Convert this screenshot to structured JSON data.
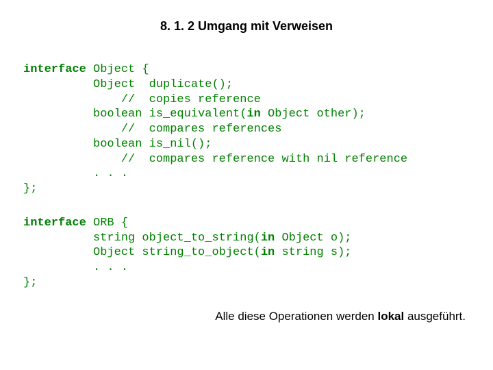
{
  "heading": "8. 1. 2  Umgang mit Verweisen",
  "code1": {
    "kw1": "interface",
    "l1b": " Object {",
    "l2": "          Object  duplicate();",
    "l3": "              //  copies reference",
    "l4a": "          boolean is_equivalent(",
    "kw_in1": "in",
    "l4b": " Object other);",
    "l5": "              //  compares references",
    "l6": "          boolean is_nil();",
    "l7": "              //  compares reference with nil reference",
    "l8": "          . . .",
    "l9": "};"
  },
  "code2": {
    "kw1": "interface",
    "l1b": " ORB {",
    "l2a": "          string object_to_string(",
    "kw_in1": "in",
    "l2b": " Object o);",
    "l3a": "          Object string_to_object(",
    "kw_in2": "in",
    "l3b": " string s);",
    "l4": "          . . .",
    "l5": "};"
  },
  "footer": {
    "t1": "Alle diese Operationen werden ",
    "b": "lokal",
    "t2": " ausgeführt."
  }
}
